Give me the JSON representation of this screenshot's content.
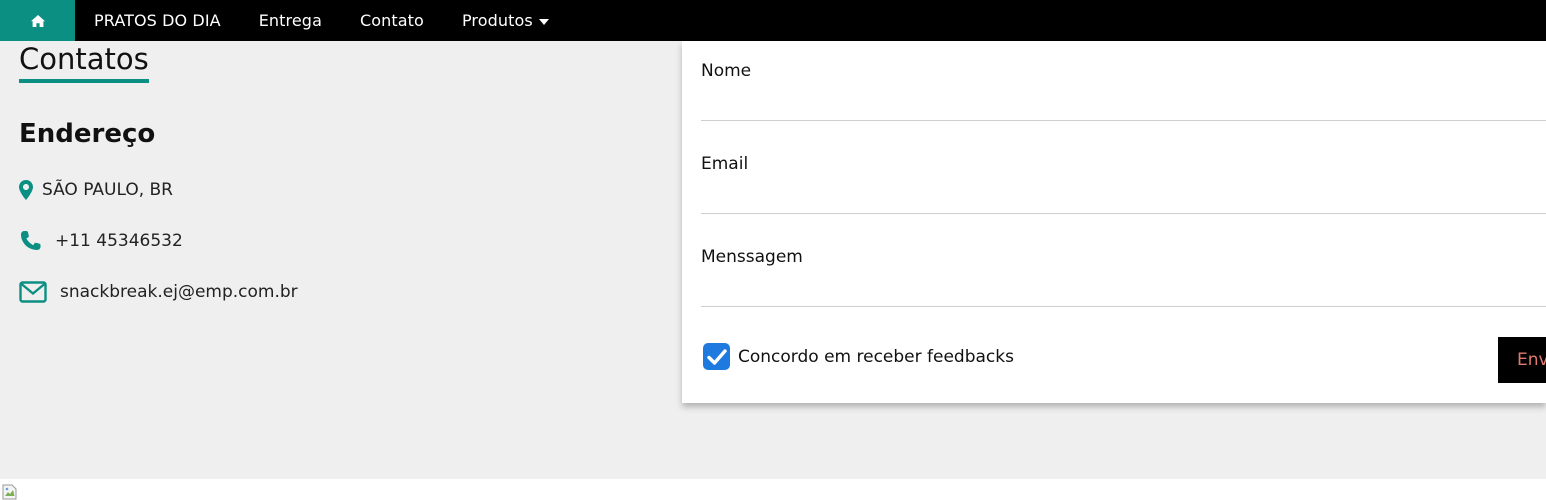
{
  "nav": {
    "home_icon": "home-icon",
    "items": [
      "PRATOS DO DIA",
      "Entrega",
      "Contato",
      "Produtos"
    ],
    "accent": "#0a8f82"
  },
  "contacts": {
    "title": "Contatos",
    "address_heading": "Endereço",
    "address": "SÃO PAULO, BR",
    "phone": "+11 45346532",
    "email": "snackbreak.ej@emp.com.br",
    "icons": [
      "map-marker-icon",
      "phone-icon",
      "envelope-icon"
    ]
  },
  "form": {
    "name_label": "Nome",
    "email_label": "Email",
    "message_label": "Menssagem",
    "name_value": "",
    "email_value": "",
    "message_value": "",
    "consent_label": "Concordo em receber feedbacks",
    "consent_checked": true,
    "submit_label": "Enviar",
    "submit_text_color": "#e07a6e"
  }
}
